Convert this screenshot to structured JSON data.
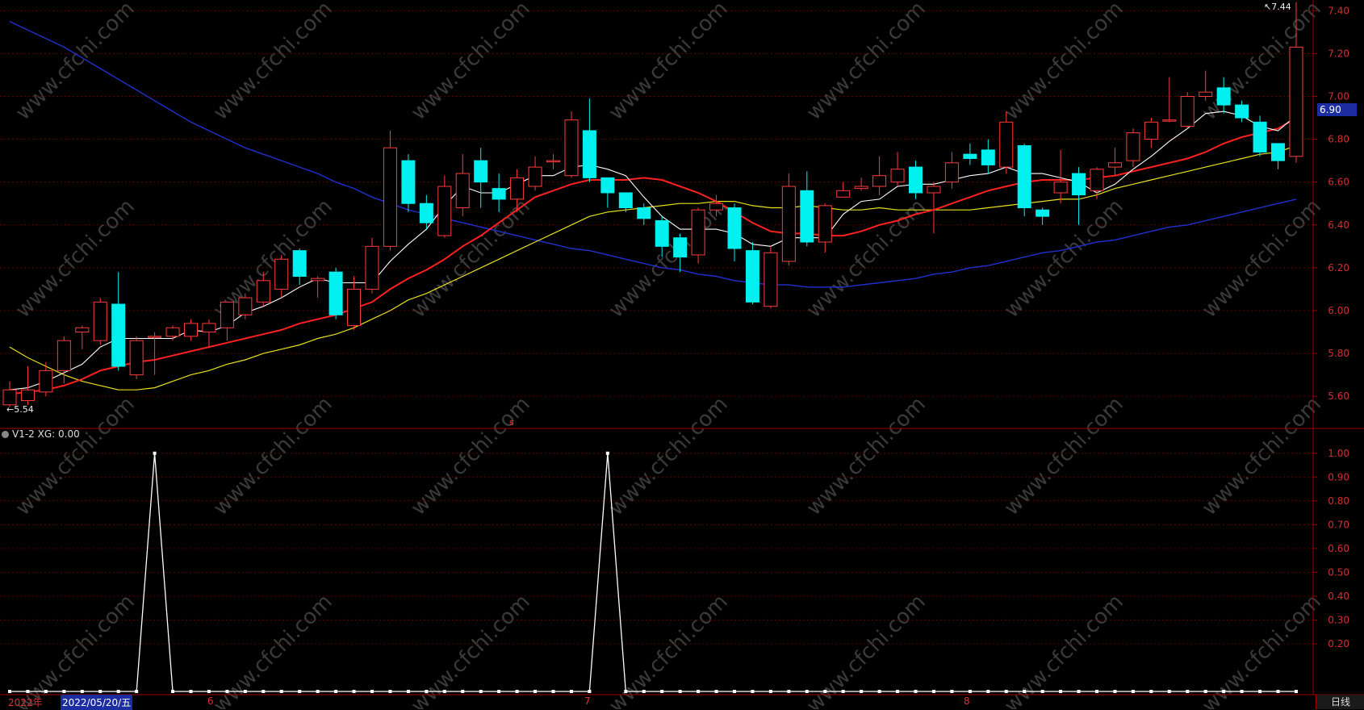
{
  "watermark": "www.cfchi.com",
  "price_axis": {
    "ticks": [
      "7.40",
      "7.20",
      "7.00",
      "6.80",
      "6.60",
      "6.40",
      "6.20",
      "6.00",
      "5.80",
      "5.60"
    ]
  },
  "osc_axis": {
    "ticks": [
      "1.00",
      "0.90",
      "0.80",
      "0.70",
      "0.60",
      "0.50",
      "0.40",
      "0.30",
      "0.20"
    ]
  },
  "current_price_badge": "6.90",
  "annotations": {
    "high": "7.44",
    "low": "5.54",
    "marker": "s"
  },
  "indicator_panel": {
    "label": "V1-2  XG: 0.00"
  },
  "bottom_bar": {
    "year": "2022年",
    "cursor_date": "2022/05/20/五",
    "months": [
      "6",
      "7",
      "8"
    ],
    "period": "日线"
  },
  "colors": {
    "up": "#ff3b3b",
    "down": "#00f0f0",
    "ma5": "#ffffff",
    "ma10": "#ff2020",
    "ma20": "#e6e020",
    "ma60": "#2030d0",
    "grid": "#5a0000",
    "axis": "#a00000"
  },
  "chart_data": {
    "type": "candlestick",
    "price_ylim": [
      5.45,
      7.45
    ],
    "candles": [
      [
        5.56,
        5.63,
        5.55,
        5.67
      ],
      [
        5.58,
        5.63,
        5.56,
        5.74
      ],
      [
        5.62,
        5.72,
        5.6,
        5.76
      ],
      [
        5.72,
        5.86,
        5.66,
        5.88
      ],
      [
        5.9,
        5.92,
        5.82,
        5.93
      ],
      [
        5.86,
        6.04,
        5.84,
        6.06
      ],
      [
        6.03,
        5.74,
        5.72,
        6.18
      ],
      [
        5.7,
        5.86,
        5.68,
        5.88
      ],
      [
        5.88,
        5.88,
        5.7,
        5.9
      ],
      [
        5.88,
        5.92,
        5.86,
        5.93
      ],
      [
        5.88,
        5.94,
        5.86,
        5.96
      ],
      [
        5.9,
        5.94,
        5.83,
        5.96
      ],
      [
        5.92,
        6.04,
        5.86,
        6.04
      ],
      [
        5.98,
        6.06,
        5.96,
        6.08
      ],
      [
        6.04,
        6.14,
        6.02,
        6.18
      ],
      [
        6.1,
        6.24,
        6.06,
        6.26
      ],
      [
        6.28,
        6.16,
        6.12,
        6.29
      ],
      [
        6.14,
        6.15,
        6.06,
        6.16
      ],
      [
        6.18,
        5.98,
        5.96,
        6.2
      ],
      [
        5.93,
        6.1,
        5.91,
        6.16
      ],
      [
        6.1,
        6.3,
        6.08,
        6.34
      ],
      [
        6.3,
        6.76,
        6.28,
        6.84
      ],
      [
        6.7,
        6.5,
        6.46,
        6.73
      ],
      [
        6.5,
        6.41,
        6.38,
        6.54
      ],
      [
        6.35,
        6.58,
        6.34,
        6.63
      ],
      [
        6.48,
        6.64,
        6.44,
        6.73
      ],
      [
        6.7,
        6.6,
        6.48,
        6.76
      ],
      [
        6.57,
        6.52,
        6.46,
        6.64
      ],
      [
        6.52,
        6.62,
        6.46,
        6.66
      ],
      [
        6.58,
        6.67,
        6.56,
        6.72
      ],
      [
        6.7,
        6.7,
        6.66,
        6.73
      ],
      [
        6.63,
        6.89,
        6.62,
        6.93
      ],
      [
        6.84,
        6.62,
        6.6,
        6.99
      ],
      [
        6.62,
        6.55,
        6.48,
        6.62
      ],
      [
        6.55,
        6.48,
        6.46,
        6.55
      ],
      [
        6.48,
        6.43,
        6.4,
        6.5
      ],
      [
        6.42,
        6.3,
        6.25,
        6.44
      ],
      [
        6.34,
        6.25,
        6.18,
        6.36
      ],
      [
        6.26,
        6.47,
        6.22,
        6.48
      ],
      [
        6.47,
        6.5,
        6.44,
        6.54
      ],
      [
        6.48,
        6.29,
        6.23,
        6.5
      ],
      [
        6.28,
        6.04,
        6.03,
        6.32
      ],
      [
        6.02,
        6.27,
        6.01,
        6.3
      ],
      [
        6.23,
        6.58,
        6.21,
        6.64
      ],
      [
        6.56,
        6.32,
        6.3,
        6.65
      ],
      [
        6.32,
        6.49,
        6.27,
        6.5
      ],
      [
        6.53,
        6.56,
        6.53,
        6.6
      ],
      [
        6.57,
        6.58,
        6.56,
        6.62
      ],
      [
        6.58,
        6.63,
        6.54,
        6.72
      ],
      [
        6.6,
        6.66,
        6.58,
        6.74
      ],
      [
        6.67,
        6.55,
        6.52,
        6.7
      ],
      [
        6.55,
        6.58,
        6.36,
        6.6
      ],
      [
        6.6,
        6.69,
        6.57,
        6.74
      ],
      [
        6.73,
        6.71,
        6.68,
        6.78
      ],
      [
        6.75,
        6.68,
        6.64,
        6.8
      ],
      [
        6.67,
        6.88,
        6.64,
        6.93
      ],
      [
        6.77,
        6.48,
        6.44,
        6.78
      ],
      [
        6.47,
        6.44,
        6.4,
        6.48
      ],
      [
        6.55,
        6.6,
        6.5,
        6.75
      ],
      [
        6.64,
        6.54,
        6.4,
        6.67
      ],
      [
        6.56,
        6.66,
        6.52,
        6.67
      ],
      [
        6.67,
        6.69,
        6.63,
        6.76
      ],
      [
        6.7,
        6.83,
        6.67,
        6.85
      ],
      [
        6.8,
        6.88,
        6.76,
        6.9
      ],
      [
        6.89,
        6.89,
        6.88,
        7.09
      ],
      [
        6.86,
        7.0,
        6.85,
        7.02
      ],
      [
        7.0,
        7.02,
        6.98,
        7.12
      ],
      [
        7.04,
        6.96,
        6.92,
        7.09
      ],
      [
        6.96,
        6.9,
        6.88,
        6.98
      ],
      [
        6.88,
        6.74,
        6.72,
        6.91
      ],
      [
        6.78,
        6.7,
        6.66,
        6.78
      ],
      [
        6.72,
        7.23,
        6.69,
        7.44
      ]
    ],
    "ma5": [
      5.63,
      5.64,
      5.67,
      5.71,
      5.75,
      5.83,
      5.87,
      5.87,
      5.87,
      5.87,
      5.91,
      5.9,
      5.93,
      5.99,
      6.02,
      6.06,
      6.11,
      6.15,
      6.13,
      6.13,
      6.13,
      6.23,
      6.31,
      6.38,
      6.49,
      6.58,
      6.55,
      6.55,
      6.59,
      6.63,
      6.63,
      6.67,
      6.68,
      6.66,
      6.63,
      6.53,
      6.44,
      6.38,
      6.38,
      6.38,
      6.36,
      6.31,
      6.3,
      6.34,
      6.34,
      6.34,
      6.45,
      6.51,
      6.52,
      6.58,
      6.59,
      6.59,
      6.61,
      6.63,
      6.64,
      6.67,
      6.64,
      6.64,
      6.62,
      6.6,
      6.55,
      6.59,
      6.66,
      6.72,
      6.79,
      6.85,
      6.92,
      6.93,
      6.91,
      6.86,
      6.84,
      6.91
    ],
    "ma10": [
      5.61,
      5.62,
      5.63,
      5.65,
      5.68,
      5.72,
      5.74,
      5.76,
      5.77,
      5.79,
      5.81,
      5.83,
      5.85,
      5.87,
      5.89,
      5.91,
      5.94,
      5.96,
      5.98,
      6.01,
      6.04,
      6.1,
      6.15,
      6.19,
      6.24,
      6.3,
      6.35,
      6.41,
      6.47,
      6.53,
      6.56,
      6.59,
      6.61,
      6.61,
      6.61,
      6.62,
      6.61,
      6.58,
      6.55,
      6.51,
      6.46,
      6.41,
      6.37,
      6.36,
      6.36,
      6.35,
      6.35,
      6.37,
      6.4,
      6.42,
      6.45,
      6.47,
      6.5,
      6.53,
      6.56,
      6.58,
      6.6,
      6.61,
      6.61,
      6.61,
      6.62,
      6.63,
      6.65,
      6.67,
      6.69,
      6.71,
      6.74,
      6.78,
      6.81,
      6.83,
      6.85,
      6.9
    ],
    "ma20": [
      5.83,
      5.78,
      5.74,
      5.7,
      5.67,
      5.65,
      5.63,
      5.63,
      5.64,
      5.67,
      5.7,
      5.72,
      5.75,
      5.77,
      5.8,
      5.82,
      5.84,
      5.87,
      5.89,
      5.92,
      5.96,
      6.0,
      6.05,
      6.08,
      6.12,
      6.16,
      6.2,
      6.24,
      6.28,
      6.32,
      6.36,
      6.4,
      6.44,
      6.46,
      6.47,
      6.48,
      6.49,
      6.5,
      6.5,
      6.51,
      6.51,
      6.49,
      6.48,
      6.48,
      6.49,
      6.48,
      6.47,
      6.47,
      6.48,
      6.47,
      6.47,
      6.47,
      6.47,
      6.47,
      6.48,
      6.49,
      6.5,
      6.51,
      6.52,
      6.52,
      6.54,
      6.57,
      6.59,
      6.61,
      6.63,
      6.65,
      6.67,
      6.69,
      6.71,
      6.73,
      6.74,
      6.77
    ],
    "ma60": [
      7.35,
      7.31,
      7.27,
      7.23,
      7.18,
      7.13,
      7.08,
      7.03,
      6.98,
      6.93,
      6.88,
      6.84,
      6.8,
      6.76,
      6.73,
      6.7,
      6.67,
      6.64,
      6.6,
      6.57,
      6.53,
      6.5,
      6.47,
      6.45,
      6.43,
      6.41,
      6.39,
      6.37,
      6.35,
      6.33,
      6.31,
      6.29,
      6.28,
      6.26,
      6.24,
      6.22,
      6.2,
      6.19,
      6.17,
      6.16,
      6.14,
      6.13,
      6.12,
      6.12,
      6.11,
      6.11,
      6.11,
      6.12,
      6.13,
      6.14,
      6.15,
      6.17,
      6.18,
      6.2,
      6.21,
      6.23,
      6.25,
      6.27,
      6.28,
      6.3,
      6.32,
      6.33,
      6.35,
      6.37,
      6.39,
      6.4,
      6.42,
      6.44,
      6.46,
      6.48,
      6.5,
      6.52
    ],
    "osc_ylim": [
      0,
      1.05
    ],
    "signal": [
      0,
      0,
      0,
      0,
      0,
      0,
      0,
      0,
      1,
      0,
      0,
      0,
      0,
      0,
      0,
      0,
      0,
      0,
      0,
      0,
      0,
      0,
      0,
      0,
      0,
      0,
      0,
      0,
      0,
      0,
      0,
      0,
      0,
      1,
      0,
      0,
      0,
      0,
      0,
      0,
      0,
      0,
      0,
      0,
      0,
      0,
      0,
      0,
      0,
      0,
      0,
      0,
      0,
      0,
      0,
      0,
      0,
      0,
      0,
      0,
      0,
      0,
      0,
      0,
      0,
      0,
      0,
      0,
      0,
      0,
      0,
      0
    ]
  }
}
